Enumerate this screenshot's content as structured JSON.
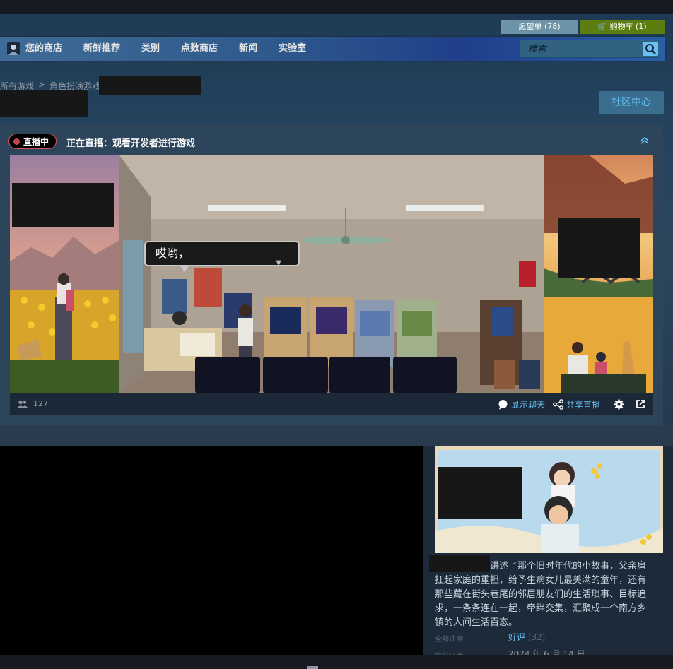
{
  "header": {
    "wishlist_label": "愿望单 (78)",
    "cart_label": "购物车 (1)"
  },
  "nav": {
    "items": [
      "您的商店",
      "新鲜推荐",
      "类别",
      "点数商店",
      "新闻",
      "实验室"
    ],
    "search_placeholder": "搜索"
  },
  "breadcrumb": {
    "items": [
      "所有游戏",
      "角色扮演游戏"
    ]
  },
  "community_hub_label": "社区中心",
  "broadcast": {
    "live_badge": "直播中",
    "title": "正在直播：观看开发者进行游戏",
    "dialog_text": "哎哟，",
    "viewer_count": "127",
    "show_chat_label": "显示聊天",
    "share_label": "共享直播"
  },
  "game": {
    "description": "讲述了那个旧时年代的小故事，父亲肩扛起家庭的重担，给予生病女儿最美满的童年，还有那些藏在街头巷尾的邻居朋友们的生活琐事、目标追求，一条条连在一起，牵绊交集，汇聚成一个南方乡镇的人间生活百态。",
    "review_label": "全部评测:",
    "review_value": "好评",
    "review_count": "(32)",
    "release_label": "发行日期:",
    "release_date": "2024 年 6 月 14 日"
  },
  "colors": {
    "accent_blue": "#67c1f5",
    "cart_green": "#5c7e10",
    "live_red": "#c1474e",
    "background": "#1b2838"
  }
}
